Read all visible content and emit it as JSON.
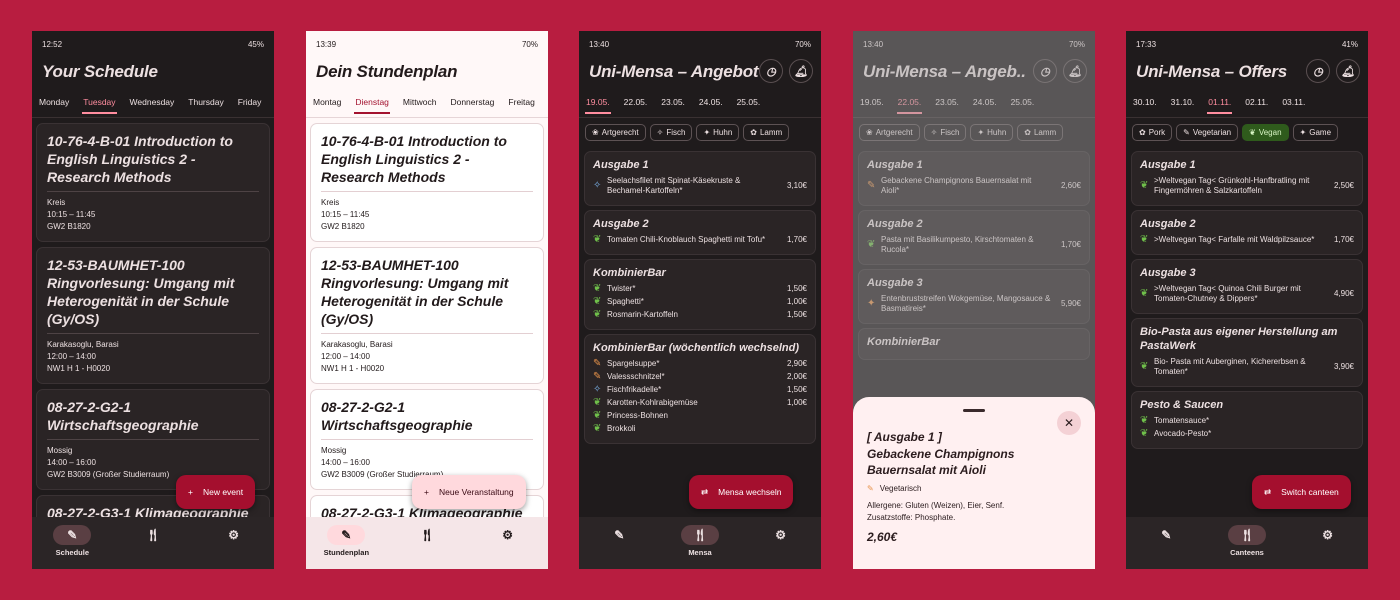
{
  "p1": {
    "time": "12:52",
    "status": "45%",
    "title": "Your Schedule",
    "tabs": [
      "Monday",
      "Tuesday",
      "Wednesday",
      "Thursday",
      "Friday"
    ],
    "cards": [
      {
        "title": "10-76-4-B-01 Introduction to English Linguistics 2 - Research Methods",
        "l1": "Kreis",
        "l2": "10:15 – 11:45",
        "l3": "GW2 B1820"
      },
      {
        "title": "12-53-BAUMHET-100 Ringvorlesung: Umgang mit Heterogenität in der Schule (Gy/OS)",
        "l1": "Karakasoglu, Barasi",
        "l2": "12:00 – 14:00",
        "l3": "NW1 H 1 - H0020"
      },
      {
        "title": "08-27-2-G2-1 Wirtschaftsgeographie",
        "l1": "Mossig",
        "l2": "14:00 – 16:00",
        "l3": "GW2 B3009 (Großer Studierraum)"
      },
      {
        "title": "08-27-2-G3-1 Klimageographie"
      }
    ],
    "fab": "New event",
    "nav": [
      "Schedule"
    ]
  },
  "p2": {
    "time": "13:39",
    "status": "70%",
    "title": "Dein Stundenplan",
    "tabs": [
      "Montag",
      "Dienstag",
      "Mittwoch",
      "Donnerstag",
      "Freitag"
    ],
    "cards": [
      {
        "title": "10-76-4-B-01 Introduction to English Linguistics 2 - Research Methods",
        "l1": "Kreis",
        "l2": "10:15 – 11:45",
        "l3": "GW2 B1820"
      },
      {
        "title": "12-53-BAUMHET-100 Ringvorlesung: Umgang mit Heterogenität in der Schule (Gy/OS)",
        "l1": "Karakasoglu, Barasi",
        "l2": "12:00 – 14:00",
        "l3": "NW1 H 1 - H0020"
      },
      {
        "title": "08-27-2-G2-1 Wirtschaftsgeographie",
        "l1": "Mossig",
        "l2": "14:00 – 16:00",
        "l3": "GW2 B3009 (Großer Studierraum)"
      },
      {
        "title": "08-27-2-G3-1 Klimageographie"
      }
    ],
    "fab": "Neue Veranstaltung",
    "nav": [
      "Stundenplan"
    ]
  },
  "p3": {
    "time": "13:40",
    "status": "70%",
    "title": "Uni-Mensa – Angebot",
    "dates": [
      "19.05.",
      "22.05.",
      "23.05.",
      "24.05.",
      "25.05."
    ],
    "chips": [
      "Artgerecht",
      "Fisch",
      "Huhn",
      "Lamm"
    ],
    "s1": "Ausgabe 1",
    "d1": "Seelachsfilet mit Spinat-Käsekruste & Bechamel-Kartoffeln*",
    "p1": "3,10€",
    "s2": "Ausgabe 2",
    "d2": "Tomaten Chili-Knoblauch Spaghetti mit Tofu*",
    "p2": "1,70€",
    "s3": "KombinierBar",
    "d3a": "Twister*",
    "p3a": "1,50€",
    "d3b": "Spaghetti*",
    "p3b": "1,00€",
    "d3c": "Rosmarin-Kartoffeln",
    "p3c": "1,50€",
    "s4": "KombinierBar (wöchentlich wechselnd)",
    "d4a": "Spargelsuppe*",
    "p4a": "2,90€",
    "d4b": "Valessschnitzel*",
    "p4b": "2,00€",
    "d4c": "Fischfrikadelle*",
    "p4c": "1,50€",
    "d4d": "Karotten-Kohlrabigemüse",
    "p4d": "1,00€",
    "d4e": "Princess-Bohnen",
    "d4f": "Brokkoli",
    "fab": "Mensa wechseln",
    "nav": [
      "Mensa"
    ]
  },
  "p4": {
    "time": "13:40",
    "status": "70%",
    "title": "Uni-Mensa – Angeb..",
    "dates": [
      "19.05.",
      "22.05.",
      "23.05.",
      "24.05.",
      "25.05."
    ],
    "chips": [
      "Artgerecht",
      "Fisch",
      "Huhn",
      "Lamm"
    ],
    "s1": "Ausgabe 1",
    "d1": "Gebackene Champignons Bauernsalat mit Aioli*",
    "p1": "2,60€",
    "s2": "Ausgabe 2",
    "d2": "Pasta mit Basilikumpesto, Kirschtomaten & Rucola*",
    "p2": "1,70€",
    "s3": "Ausgabe 3",
    "d3": "Entenbruststreifen Wokgemüse, Mangosauce & Basmatireis*",
    "p3": "5,90€",
    "s4": "KombinierBar",
    "sheet": {
      "head": "[ Ausgabe 1 ]",
      "name": "Gebackene Champignons Bauernsalat mit Aioli",
      "tag": "Vegetarisch",
      "allergens": "Allergene:",
      "allergens_val": "Gluten (Weizen), Eier, Senf.",
      "additives": "Zusatzstoffe: Phosphate.",
      "price": "2,60€"
    }
  },
  "p5": {
    "time": "17:33",
    "status": "41%",
    "title": "Uni-Mensa – Offers",
    "dates": [
      "30.10.",
      "31.10.",
      "01.11.",
      "02.11.",
      "03.11."
    ],
    "chips": [
      "Pork",
      "Vegetarian",
      "Vegan",
      "Game"
    ],
    "s1": "Ausgabe 1",
    "d1": ">Weltvegan Tag< Grünkohl-Hanfbratling mit Fingermöhren & Salzkartoffeln",
    "p1": "2,50€",
    "s2": "Ausgabe 2",
    "d2": ">Weltvegan Tag< Farfalle mit Waldpilzsauce*",
    "p2": "1,70€",
    "s3": "Ausgabe 3",
    "d3": ">Weltvegan Tag< Quinoa Chili Burger mit Tomaten-Chutney & Dippers*",
    "p3": "4,90€",
    "s4": "Bio-Pasta aus eigener Herstellung am PastaWerk",
    "d4": "Bio- Pasta mit Auberginen, Kichererbsen & Tomaten*",
    "p4": "3,90€",
    "s5": "Pesto & Saucen",
    "d5a": "Tomatensauce*",
    "d5b": "Avocado-Pesto*",
    "fab": "Switch canteen",
    "nav": [
      "Canteens"
    ]
  },
  "colors": {
    "background": "#b81d40",
    "accent": "#a40f2e",
    "vegan": "#6fbf4a"
  }
}
